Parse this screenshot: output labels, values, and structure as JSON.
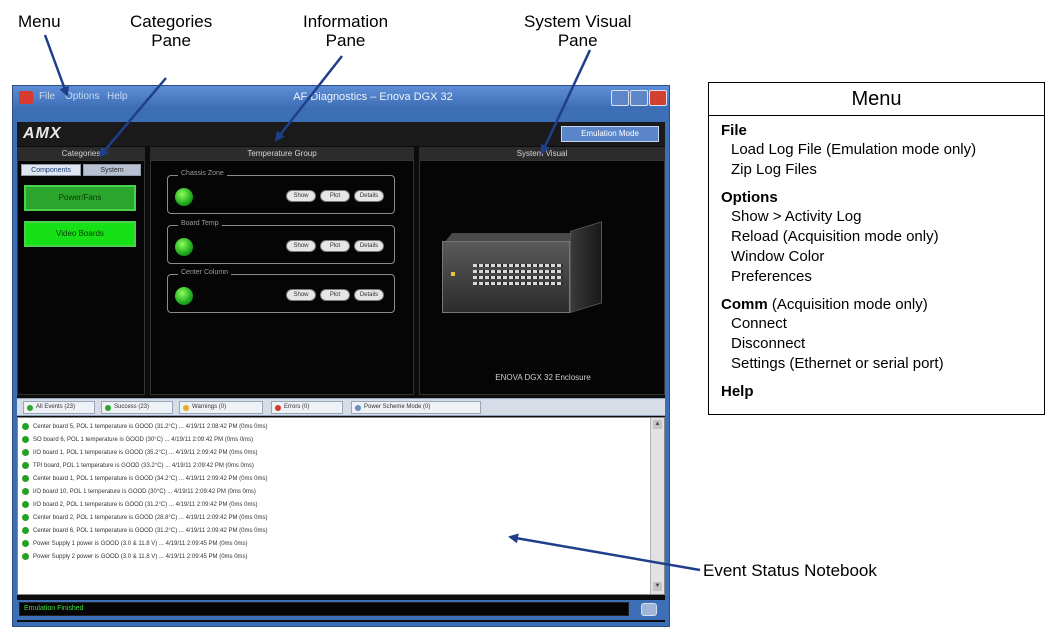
{
  "callouts": {
    "menu": "Menu",
    "categories_line1": "Categories",
    "categories_line2": "Pane",
    "information_line1": "Information",
    "information_line2": "Pane",
    "system_visual_line1": "System Visual",
    "system_visual_line2": "Pane",
    "event_status_notebook": "Event Status Notebook"
  },
  "app_window": {
    "title": "AF Diagnostics – Enova DGX 32",
    "menubar": [
      "File",
      "Options",
      "Help"
    ],
    "logo": "AMX",
    "mode_button": "Emulation Mode",
    "pane_headers": {
      "categories": "Categories",
      "information": "Temperature Group",
      "system_visual": "System Visual"
    },
    "category_tabs": [
      "Components",
      "System"
    ],
    "category_buttons": [
      "Power/Fans",
      "Video Boards"
    ],
    "temperature_groups": [
      {
        "label": "Chassis Zone",
        "buttons": [
          "Show",
          "Plot",
          "Details"
        ]
      },
      {
        "label": "Board Temp",
        "buttons": [
          "Show",
          "Plot",
          "Details"
        ]
      },
      {
        "label": "Center Column",
        "buttons": [
          "Show",
          "Plot",
          "Details"
        ]
      }
    ],
    "device_label": "ENOVA DGX 32 Enclosure",
    "event_tabs": [
      {
        "label": "All Events (23)",
        "dot": "#31a531"
      },
      {
        "label": "Success (23)",
        "dot": "#31a531"
      },
      {
        "label": "Warnings (0)",
        "dot": "#e0b020"
      },
      {
        "label": "Errors (0)",
        "dot": "#d23a2a"
      },
      {
        "label": "Power Scheme Mode (0)",
        "dot": "#6a8bc3"
      }
    ],
    "log_rows": [
      "Center board 5, POL 1 temperature is GOOD (31.2°C) ... 4/19/11 2:08:42 PM (0ms 0ms)",
      "SO board 6, POL 1 temperature is GOOD (30°C) ... 4/19/11 2:09:42 PM (0ms 0ms)",
      "I/O board 1, POL 1 temperature is GOOD (35.2°C) ... 4/19/11 2:09:42 PM (0ms 0ms)",
      "TPI board, POL 1 temperature is GOOD (33.2°C) ... 4/19/11 2:09:42 PM (0ms 0ms)",
      "Center board 1, POL 1 temperature is GOOD (34.2°C) ... 4/19/11 2:09:42 PM (0ms 0ms)",
      "I/O board 10, POL 1 temperature is GOOD (30°C) ... 4/19/11 2:09:42 PM (0ms 0ms)",
      "I/O board 2, POL 1 temperature is GOOD (31.2°C) ... 4/19/11 2:09:42 PM (0ms 0ms)",
      "Center board 2, POL 1 temperature is GOOD (28.8°C) ... 4/19/11 2:09:42 PM (0ms 0ms)",
      "Center board 6, POL 1 temperature is GOOD (31.2°C) ... 4/19/11 2:09:42 PM (0ms 0ms)",
      "Power Supply 1 power is GOOD (3.0 & 11.8 V) ... 4/19/11 2:09:45 PM (0ms 0ms)",
      "Power Supply 2 power is GOOD (3.0 & 11.8 V) ... 4/19/11 2:09:45 PM (0ms 0ms)"
    ],
    "status_text": "Emulation Finished"
  },
  "legend": {
    "title": "Menu",
    "lines": [
      {
        "text": "File",
        "bold": true
      },
      {
        "text": "Load Log File (Emulation mode only)",
        "bold": false
      },
      {
        "text": "Zip Log Files",
        "bold": false
      },
      {
        "text": "Options",
        "bold": true
      },
      {
        "text": "Show > Activity Log",
        "bold": false
      },
      {
        "text": "Reload (Acquisition mode only)",
        "bold": false
      },
      {
        "text": "Window Color",
        "bold": false
      },
      {
        "text": "Preferences",
        "bold": false
      },
      {
        "text": "Comm",
        "bold": true,
        "suffix": " (Acquisition mode only)"
      },
      {
        "text": "Connect",
        "bold": false
      },
      {
        "text": "Disconnect",
        "bold": false
      },
      {
        "text": "Settings (Ethernet or serial port)",
        "bold": false
      },
      {
        "text": "Help",
        "bold": true
      }
    ]
  },
  "colors": {
    "arrow": "#1f3f8c",
    "window_frame": "#3d6fb6",
    "category_button_on": "#16e016",
    "status_text": "#3ddf3d"
  }
}
